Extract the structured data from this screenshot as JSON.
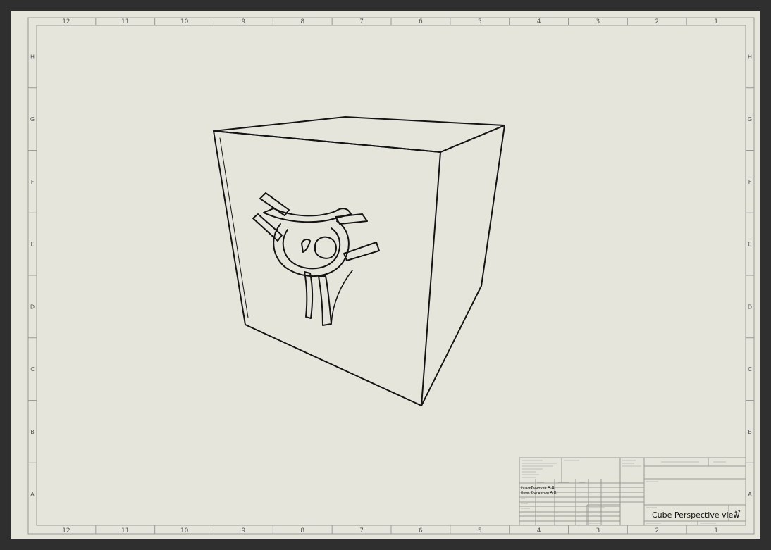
{
  "colors": {
    "paper": "#e6e5db",
    "frame": "#9a9a96",
    "ink": "#141414",
    "background": "#2f2f2f"
  },
  "zones": {
    "columns": [
      "12",
      "11",
      "10",
      "9",
      "8",
      "7",
      "6",
      "5",
      "4",
      "3",
      "2",
      "1"
    ],
    "rows": [
      "H",
      "G",
      "F",
      "E",
      "D",
      "C",
      "B",
      "A"
    ]
  },
  "title_block": {
    "drawn_by_label": "Разраб.",
    "drawn_by": "Горнова А.Д.",
    "checked_by_label": "Пров.",
    "checked_by": "Богданов А.Н.",
    "title": "Cube Perspective view",
    "sheet_size": "A2"
  }
}
